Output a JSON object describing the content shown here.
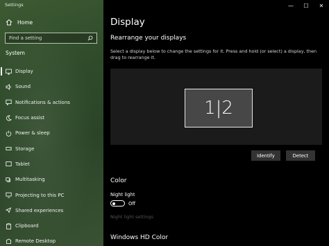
{
  "window": {
    "title": "Settings",
    "controls": {
      "minimize": "—",
      "maximize": "☐",
      "close": "✕"
    }
  },
  "sidebar": {
    "home_label": "Home",
    "search_placeholder": "Find a setting",
    "section_label": "System",
    "items": [
      {
        "label": "Display",
        "icon": "monitor-icon",
        "active": true
      },
      {
        "label": "Sound",
        "icon": "speaker-icon"
      },
      {
        "label": "Notifications & actions",
        "icon": "notification-icon"
      },
      {
        "label": "Focus assist",
        "icon": "moon-icon"
      },
      {
        "label": "Power & sleep",
        "icon": "power-icon"
      },
      {
        "label": "Storage",
        "icon": "storage-icon"
      },
      {
        "label": "Tablet",
        "icon": "tablet-icon"
      },
      {
        "label": "Multitasking",
        "icon": "multitasking-icon"
      },
      {
        "label": "Projecting to this PC",
        "icon": "projecting-icon"
      },
      {
        "label": "Shared experiences",
        "icon": "shared-icon"
      },
      {
        "label": "Clipboard",
        "icon": "clipboard-icon"
      },
      {
        "label": "Remote Desktop",
        "icon": "remote-desktop-icon"
      }
    ]
  },
  "main": {
    "title": "Display",
    "rearrange_heading": "Rearrange your displays",
    "rearrange_desc": "Select a display below to change the settings for it. Press and hold (or select) a display, then drag to rearrange it.",
    "monitor_label": "1|2",
    "identify_label": "Identify",
    "detect_label": "Detect",
    "color_heading": "Color",
    "night_light_label": "Night light",
    "night_light_state": "Off",
    "night_light_settings": "Night light settings",
    "hd_color_heading": "Windows HD Color"
  },
  "colors": {
    "sidebar_green": "#2e4a2a",
    "background": "#000000",
    "display_area": "#1b1b1b",
    "button": "#333333",
    "disabled_text": "#555555"
  }
}
